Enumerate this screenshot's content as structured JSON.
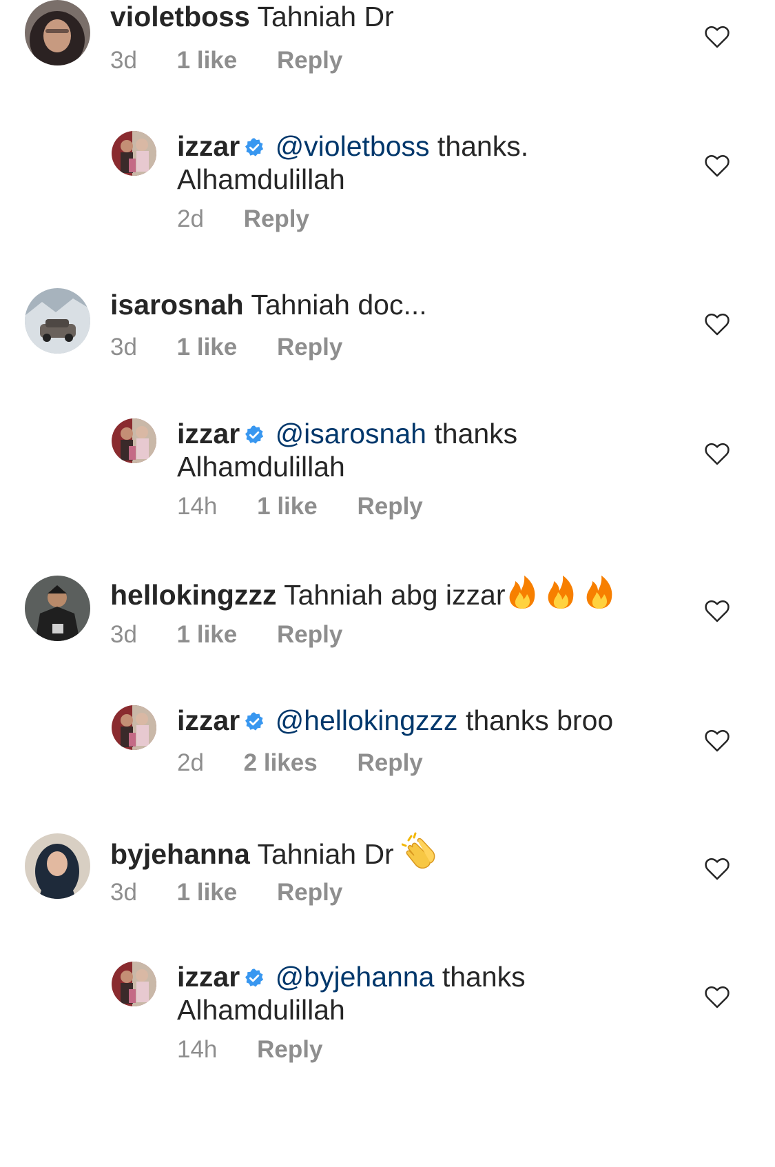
{
  "comments": [
    {
      "username": "violetboss",
      "text": "Tahniah Dr",
      "time": "3d",
      "likes": "1 like",
      "reply_label": "Reply"
    },
    {
      "username": "izzar",
      "verified": true,
      "mention": "@violetboss",
      "text": "thanks. Alhamdulillah",
      "time": "2d",
      "reply_label": "Reply"
    },
    {
      "username": "isarosnah",
      "text": "Tahniah doc...",
      "time": "3d",
      "likes": "1 like",
      "reply_label": "Reply"
    },
    {
      "username": "izzar",
      "verified": true,
      "mention": "@isarosnah",
      "text": "thanks Alhamdulillah",
      "time": "14h",
      "likes": "1 like",
      "reply_label": "Reply"
    },
    {
      "username": "hellokingzzz",
      "text": "Tahniah abg izzar",
      "emoji": "fire-icon x3",
      "time": "3d",
      "likes": "1 like",
      "reply_label": "Reply"
    },
    {
      "username": "izzar",
      "verified": true,
      "mention": "@hellokingzzz",
      "text": "thanks broo",
      "time": "2d",
      "likes": "2 likes",
      "reply_label": "Reply"
    },
    {
      "username": "byjehanna",
      "text": "Tahniah Dr",
      "emoji": "clapping-hands-icon",
      "time": "3d",
      "likes": "1 like",
      "reply_label": "Reply"
    },
    {
      "username": "izzar",
      "verified": true,
      "mention": "@byjehanna",
      "text": "thanks Alhamdulillah",
      "time": "14h",
      "reply_label": "Reply"
    }
  ],
  "colors": {
    "text": "#262626",
    "meta": "#8e8e8e",
    "mention": "#00376b",
    "verified": "#3897f0",
    "background": "#ffffff"
  }
}
